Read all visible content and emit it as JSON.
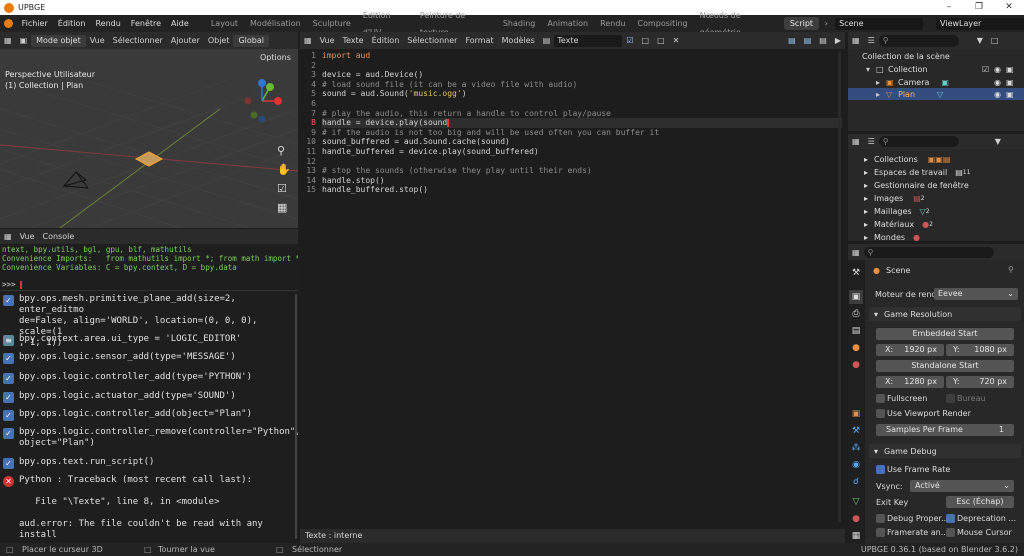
{
  "window": {
    "title": "UPBGE"
  },
  "menu": [
    "Fichier",
    "Édition",
    "Rendu",
    "Fenêtre",
    "Aide"
  ],
  "workspaces": [
    "Layout",
    "Modélisation",
    "Sculpture",
    "Édition d'UV",
    "Peinture de texture",
    "Shading",
    "Animation",
    "Rendu",
    "Compositing",
    "Nœuds de géométrie",
    "Script"
  ],
  "scene_field": "Scene",
  "viewlayer_field": "ViewLayer",
  "viewport": {
    "mode": "Mode objet",
    "menus": [
      "Vue",
      "Sélectionner",
      "Ajouter",
      "Objet"
    ],
    "transform": "Global",
    "options": "Options",
    "overlay_title": "Perspective Utilisateur",
    "overlay_sub": "(1) Collection | Plan"
  },
  "console": {
    "menus": [
      "Vue",
      "Console"
    ],
    "lines": [
      "ntext, bpy.utils, bgl, gpu, blf, mathutils",
      "Convenience Imports:   from mathutils import *; from math import *",
      "Convenience Variables: C = bpy.context, D = bpy.data"
    ],
    "prompt": ">>> ",
    "info": [
      {
        "kind": "check",
        "text": "bpy.ops.mesh.primitive_plane_add(size=2, enter_editmo\nde=False, align='WORLD', location=(0, 0, 0), scale=(1\n, 1, 1))"
      },
      {
        "kind": "edit",
        "text": "bpy.context.area.ui_type = 'LOGIC_EDITOR'"
      },
      {
        "kind": "check",
        "text": "bpy.ops.logic.sensor_add(type='MESSAGE')"
      },
      {
        "kind": "check",
        "text": "bpy.ops.logic.controller_add(type='PYTHON')"
      },
      {
        "kind": "check",
        "text": "bpy.ops.logic.actuator_add(type='SOUND')"
      },
      {
        "kind": "check",
        "text": "bpy.ops.logic.controller_add(object=\"Plan\")"
      },
      {
        "kind": "check",
        "text": "bpy.ops.logic.controller_remove(controller=\"Python\",\nobject=\"Plan\")"
      },
      {
        "kind": "check",
        "text": "bpy.ops.text.run_script()"
      },
      {
        "kind": "error",
        "text": "Python : Traceback (most recent call last):\n\n   File \"\\Texte\", line 8, in <module>\n\naud.error: The file couldn't be read with any install\ned file reader."
      }
    ]
  },
  "editor": {
    "menus": [
      "Vue",
      "Texte",
      "Édition",
      "Sélectionner",
      "Format",
      "Modèles"
    ],
    "text_name": "Texte",
    "footer": "Texte : interne",
    "lines": [
      "import aud",
      "",
      "device = aud.Device()",
      "# load sound file (it can be a video file with audio)",
      "sound = aud.Sound('music.ogg')",
      "",
      "# play the audio, this return a handle to control play/pause",
      "handle = device.play(sound",
      "# if the audio is not too big and will be used often you can buffer it",
      "sound_buffered = aud.Sound.cache(sound)",
      "handle_buffered = device.play(sound_buffered)",
      "",
      "# stop the sounds (otherwise they play until their ends)",
      "handle.stop()",
      "handle_buffered.stop()"
    ],
    "line_numbers": [
      "1",
      "2",
      "3",
      "4",
      "5",
      "6",
      "7",
      "8",
      "9",
      "10",
      "11",
      "12",
      "13",
      "14",
      "15"
    ],
    "error_line_marker": "B"
  },
  "outliner": {
    "root": "Collection de la scène",
    "items": [
      "Collection",
      "Camera",
      "Plan"
    ]
  },
  "datablocks": {
    "items": [
      "Collections",
      "Espaces de travail",
      "Gestionnaire de fenêtre",
      "Images",
      "Maillages",
      "Matériaux",
      "Mondes"
    ],
    "counts": [
      "",
      "11",
      "",
      "2",
      "2",
      "2",
      ""
    ]
  },
  "properties": {
    "scene_label": "Scene",
    "render_engine_label": "Moteur de rendu",
    "render_engine": "Eevee",
    "game_resolution": "Game Resolution",
    "embedded_start": "Embedded Start",
    "emb_x_label": "X:",
    "emb_x": "1920 px",
    "emb_y_label": "Y:",
    "emb_y": "1080 px",
    "standalone_start": "Standalone Start",
    "sa_x_label": "X:",
    "sa_x": "1280 px",
    "sa_y_label": "Y:",
    "sa_y": "720 px",
    "fullscreen": "Fullscreen",
    "bureau": "Bureau",
    "use_viewport_render": "Use Viewport Render",
    "samples_label": "Samples Per Frame",
    "samples_value": "1",
    "game_debug": "Game Debug",
    "use_frame_rate": "Use Frame Rate",
    "vsync_label": "Vsync:",
    "vsync_value": "Activé",
    "exit_key_label": "Exit Key",
    "exit_key_value": "Esc (Échap)",
    "debug_props": "Debug Proper...",
    "deprecation": "Deprecation ...",
    "framerate": "Framerate an...",
    "mouse_cursor": "Mouse Cursor"
  },
  "statusbar": {
    "left1": "Placer le curseur 3D",
    "left2": "Tourner la vue",
    "left3": "Sélectionner",
    "version": "UPBGE 0.36.1 (based on Blender 3.6.2)"
  },
  "colors": {
    "accent": "#4772b3",
    "orange": "#e87d0d",
    "error": "#cc3333"
  }
}
